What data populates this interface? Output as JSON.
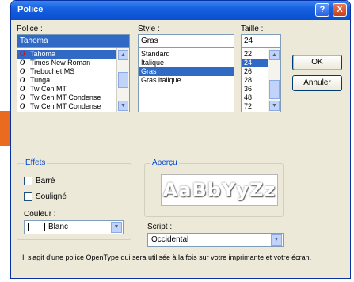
{
  "title": "Police",
  "titlebar_buttons": {
    "help": "?",
    "close": "X"
  },
  "font": {
    "label": "Police :",
    "value": "Tahoma",
    "items": [
      {
        "icon": "O",
        "name": "Tahoma",
        "selected": true
      },
      {
        "icon": "O",
        "name": "Times New Roman"
      },
      {
        "icon": "O",
        "name": "Trebuchet MS"
      },
      {
        "icon": "O",
        "name": "Tunga"
      },
      {
        "icon": "O",
        "name": "Tw Cen MT"
      },
      {
        "icon": "O",
        "name": "Tw Cen MT Condense"
      },
      {
        "icon": "O",
        "name": "Tw Cen MT Condense"
      }
    ]
  },
  "style": {
    "label": "Style :",
    "value": "Gras",
    "items": [
      {
        "name": "Standard"
      },
      {
        "name": "Italique"
      },
      {
        "name": "Gras",
        "selected": true
      },
      {
        "name": "Gras italique"
      }
    ]
  },
  "size": {
    "label": "Taille :",
    "value": "24",
    "items": [
      {
        "name": "22"
      },
      {
        "name": "24",
        "selected": true
      },
      {
        "name": "26"
      },
      {
        "name": "28"
      },
      {
        "name": "36"
      },
      {
        "name": "48"
      },
      {
        "name": "72"
      }
    ]
  },
  "buttons": {
    "ok": "OK",
    "cancel": "Annuler"
  },
  "effects": {
    "title": "Effets",
    "strikeout": "Barré",
    "underline": "Souligné",
    "color_label": "Couleur :",
    "color_value": "Blanc"
  },
  "preview": {
    "title": "Aperçu",
    "sample": "AaBbYyZz"
  },
  "script": {
    "label": "Script :",
    "value": "Occidental"
  },
  "description": "Il s'agit d'une police OpenType qui sera utilisée à la fois sur votre imprimante et votre écran.",
  "colors": {
    "titlebar": "#0b4fcf",
    "selection": "#316ac5",
    "dialog_bg": "#ece9d8",
    "side_tab": "#ea6a20"
  },
  "icons": {
    "font_item": "opentype-icon",
    "scroll_up": "arrow-up-icon",
    "scroll_down": "arrow-down-icon",
    "dropdown": "chevron-down-icon"
  }
}
